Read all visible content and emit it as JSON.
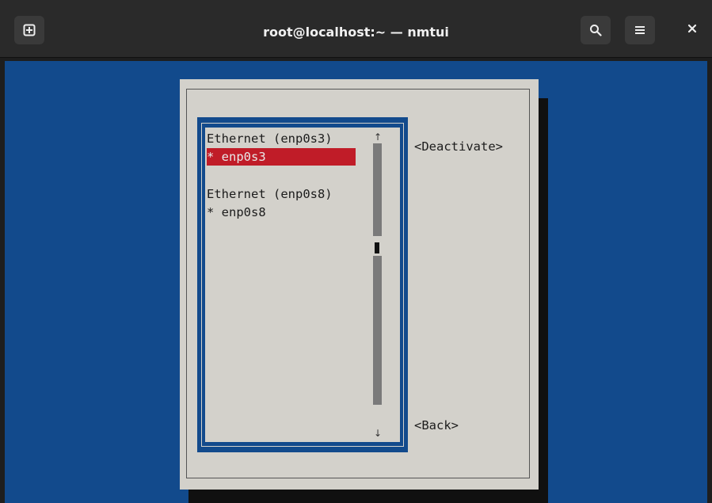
{
  "window": {
    "title": "root@localhost:~ — nmtui"
  },
  "header": {
    "new_tab_icon": "new-tab-icon",
    "search_icon": "search-icon",
    "menu_icon": "hamburger-menu-icon",
    "close_icon": "close-icon"
  },
  "colors": {
    "header_bg": "#2a2a2a",
    "terminal_bg": "#124a8c",
    "dialog_bg": "#d3d1cb",
    "selection_bg": "#c01c28"
  },
  "connections": {
    "groups": [
      {
        "header": "Ethernet (enp0s3)",
        "items": [
          {
            "label": "* enp0s3",
            "selected": true
          }
        ]
      },
      {
        "header": "Ethernet (enp0s8)",
        "items": [
          {
            "label": "* enp0s8",
            "selected": false
          }
        ]
      }
    ],
    "scroll_up": "↑",
    "scroll_down": "↓"
  },
  "actions": {
    "deactivate": "<Deactivate>",
    "back": "<Back>"
  }
}
